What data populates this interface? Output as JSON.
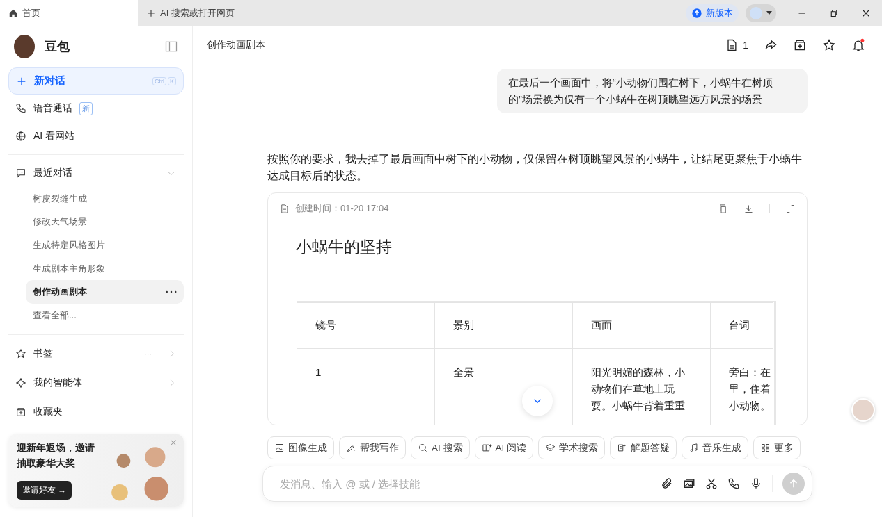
{
  "tabs": [
    {
      "label": "首页",
      "selected": true,
      "kind": "home"
    },
    {
      "label": "AI 搜索或打开网页",
      "selected": false,
      "kind": "new"
    }
  ],
  "titlebar": {
    "update_button": "新版本"
  },
  "sidebar": {
    "app_name": "豆包",
    "new_chat": {
      "label": "新对话",
      "shortcut": [
        "Ctrl",
        "K"
      ]
    },
    "top_items": [
      {
        "label": "语音通话",
        "badge": "新",
        "kind": "phone"
      },
      {
        "label": "AI 看网站",
        "kind": "globe"
      }
    ],
    "recent": {
      "label": "最近对话",
      "expanded": true,
      "items": [
        {
          "label": "树皮裂缝生成",
          "selected": false
        },
        {
          "label": "修改天气场景",
          "selected": false
        },
        {
          "label": "生成特定风格图片",
          "selected": false
        },
        {
          "label": "生成剧本主角形象",
          "selected": false
        },
        {
          "label": "创作动画剧本",
          "selected": true
        }
      ],
      "see_all": "查看全部..."
    },
    "bottom_items": [
      {
        "label": "书签",
        "kind": "star",
        "more": "···",
        "chevron": true
      },
      {
        "label": "我的智能体",
        "kind": "sparkle",
        "chevron": true
      },
      {
        "label": "收藏夹",
        "kind": "box",
        "chevron": false
      }
    ],
    "promo": {
      "text": "迎新年返场，邀请抽取豪华大奖",
      "button": "邀请好友 →"
    }
  },
  "main": {
    "title": "创作动画剧本",
    "doc_count": "1",
    "user_message": "在最后一个画面中，将“小动物们围在树下，小蜗牛在树顶的”场景换为仅有一个小蜗牛在树顶眺望远方风景的场景",
    "reply": "按照你的要求，我去掉了最后画面中树下的小动物，仅保留在树顶眺望风景的小蜗牛，让结尾更聚焦于小蜗牛达成目标后的状态。",
    "document": {
      "created": "创建时间：01-20 17:04",
      "title": "小蜗牛的坚持",
      "columns": [
        "镜号",
        "景别",
        "画面",
        "台词"
      ],
      "rows": [
        {
          "cells": [
            [
              "1"
            ],
            [
              "全景"
            ],
            [
              "阳光明媚的森林，小",
              "动物们在草地上玩",
              "耍。小蜗牛背着重重"
            ],
            [
              "旁白：在",
              "里，住着",
              "小动物。"
            ]
          ]
        }
      ]
    }
  },
  "skills": [
    {
      "label": "图像生成",
      "kind": "image"
    },
    {
      "label": "帮我写作",
      "kind": "pen"
    },
    {
      "label": "AI 搜索",
      "kind": "search"
    },
    {
      "label": "AI 阅读",
      "kind": "book"
    },
    {
      "label": "学术搜索",
      "kind": "cap"
    },
    {
      "label": "解题答疑",
      "kind": "quiz"
    },
    {
      "label": "音乐生成",
      "kind": "music"
    },
    {
      "label": "更多",
      "kind": "grid"
    }
  ],
  "input": {
    "placeholder": "发消息、输入 @ 或 / 选择技能"
  }
}
